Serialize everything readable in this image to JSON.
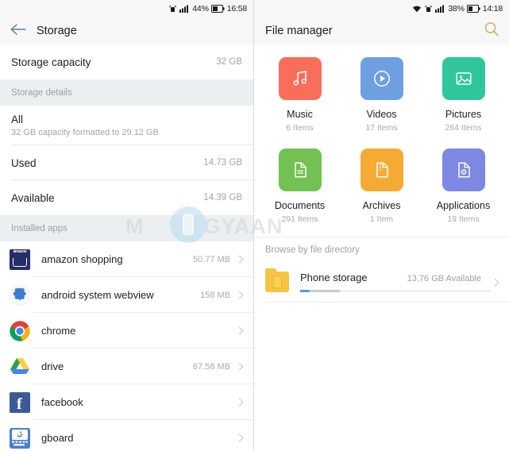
{
  "left": {
    "statusbar": {
      "icons": [
        "hotspot-icon",
        "signal-icon"
      ],
      "battery_percent": "44%",
      "time": "16:58"
    },
    "appbar": {
      "back_icon": "back-arrow-icon",
      "title": "Storage"
    },
    "capacity_row": {
      "label": "Storage capacity",
      "value": "32 GB"
    },
    "details_header": "Storage details",
    "all_row": {
      "title": "All",
      "subtitle": "32 GB capacity formatted to 29.12 GB"
    },
    "used_row": {
      "label": "Used",
      "value": "14.73 GB"
    },
    "available_row": {
      "label": "Available",
      "value": "14.39 GB"
    },
    "installed_header": "Installed apps",
    "apps": [
      {
        "name": "amazon shopping",
        "size": "50.77 MB",
        "icon": "amazon-icon"
      },
      {
        "name": "android system webview",
        "size": "158 MB",
        "icon": "gear-icon"
      },
      {
        "name": "chrome",
        "size": "",
        "icon": "chrome-icon"
      },
      {
        "name": "drive",
        "size": "67.58 MB",
        "icon": "drive-icon"
      },
      {
        "name": "facebook",
        "size": "",
        "icon": "facebook-icon"
      },
      {
        "name": "gboard",
        "size": "",
        "icon": "gboard-icon"
      }
    ]
  },
  "watermark": {
    "text_left": "M",
    "text_right": "BIGYAAN",
    "logo": "phone-badge-icon"
  },
  "right": {
    "statusbar": {
      "icons": [
        "wifi-icon",
        "hotspot-icon",
        "signal-icon"
      ],
      "battery_percent": "38%",
      "time": "14:18"
    },
    "appbar": {
      "title": "File manager",
      "search_icon": "search-icon"
    },
    "categories": [
      {
        "name": "Music",
        "count": "6 Items",
        "color": "#f96e5b",
        "icon": "music-note-icon"
      },
      {
        "name": "Videos",
        "count": "17 Items",
        "color": "#6e9fe0",
        "icon": "play-circle-icon"
      },
      {
        "name": "Pictures",
        "count": "264 Items",
        "color": "#2fc69c",
        "icon": "image-icon"
      },
      {
        "name": "Documents",
        "count": "291 Items",
        "color": "#73c153",
        "icon": "document-icon"
      },
      {
        "name": "Archives",
        "count": "1 Item",
        "color": "#f5ab33",
        "icon": "archive-icon"
      },
      {
        "name": "Applications",
        "count": "19 Items",
        "color": "#7e87e2",
        "icon": "apk-file-icon"
      }
    ],
    "browse_header": "Browse by file directory",
    "phone_storage": {
      "name": "Phone storage",
      "available": "13.76 GB Available",
      "icon": "folder-icon",
      "bar_blue_percent": 5,
      "bar_gray_percent": 16
    }
  }
}
